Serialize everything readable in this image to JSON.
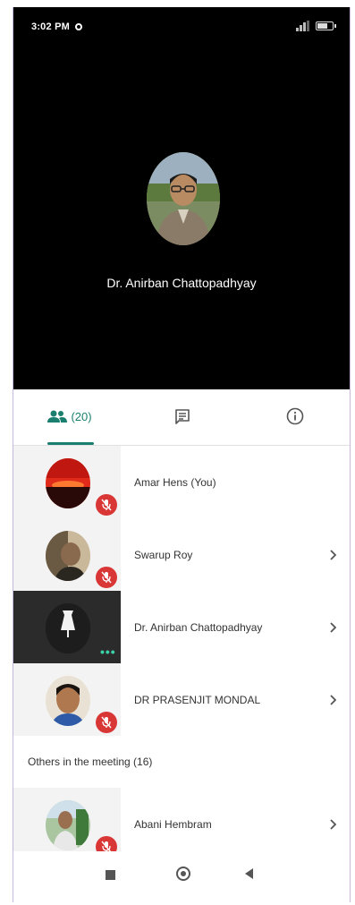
{
  "status_bar": {
    "time": "3:02 PM",
    "battery": ""
  },
  "main_video": {
    "participant_name": "Dr. Anirban Chattopadhyay"
  },
  "tabs": {
    "people_count": "(20)"
  },
  "participants": [
    {
      "name": "Amar Hens (You)"
    },
    {
      "name": "Swarup Roy"
    },
    {
      "name": "Dr. Anirban Chattopadhyay"
    },
    {
      "name": "DR PRASENJIT MONDAL"
    }
  ],
  "others_section": {
    "label": "Others in the meeting (16)"
  },
  "others": [
    {
      "name": "Abani Hembram"
    }
  ],
  "colors": {
    "accent": "#1a7f6e",
    "mute": "#d93636",
    "speaking_dots": "#3ad2a6"
  }
}
